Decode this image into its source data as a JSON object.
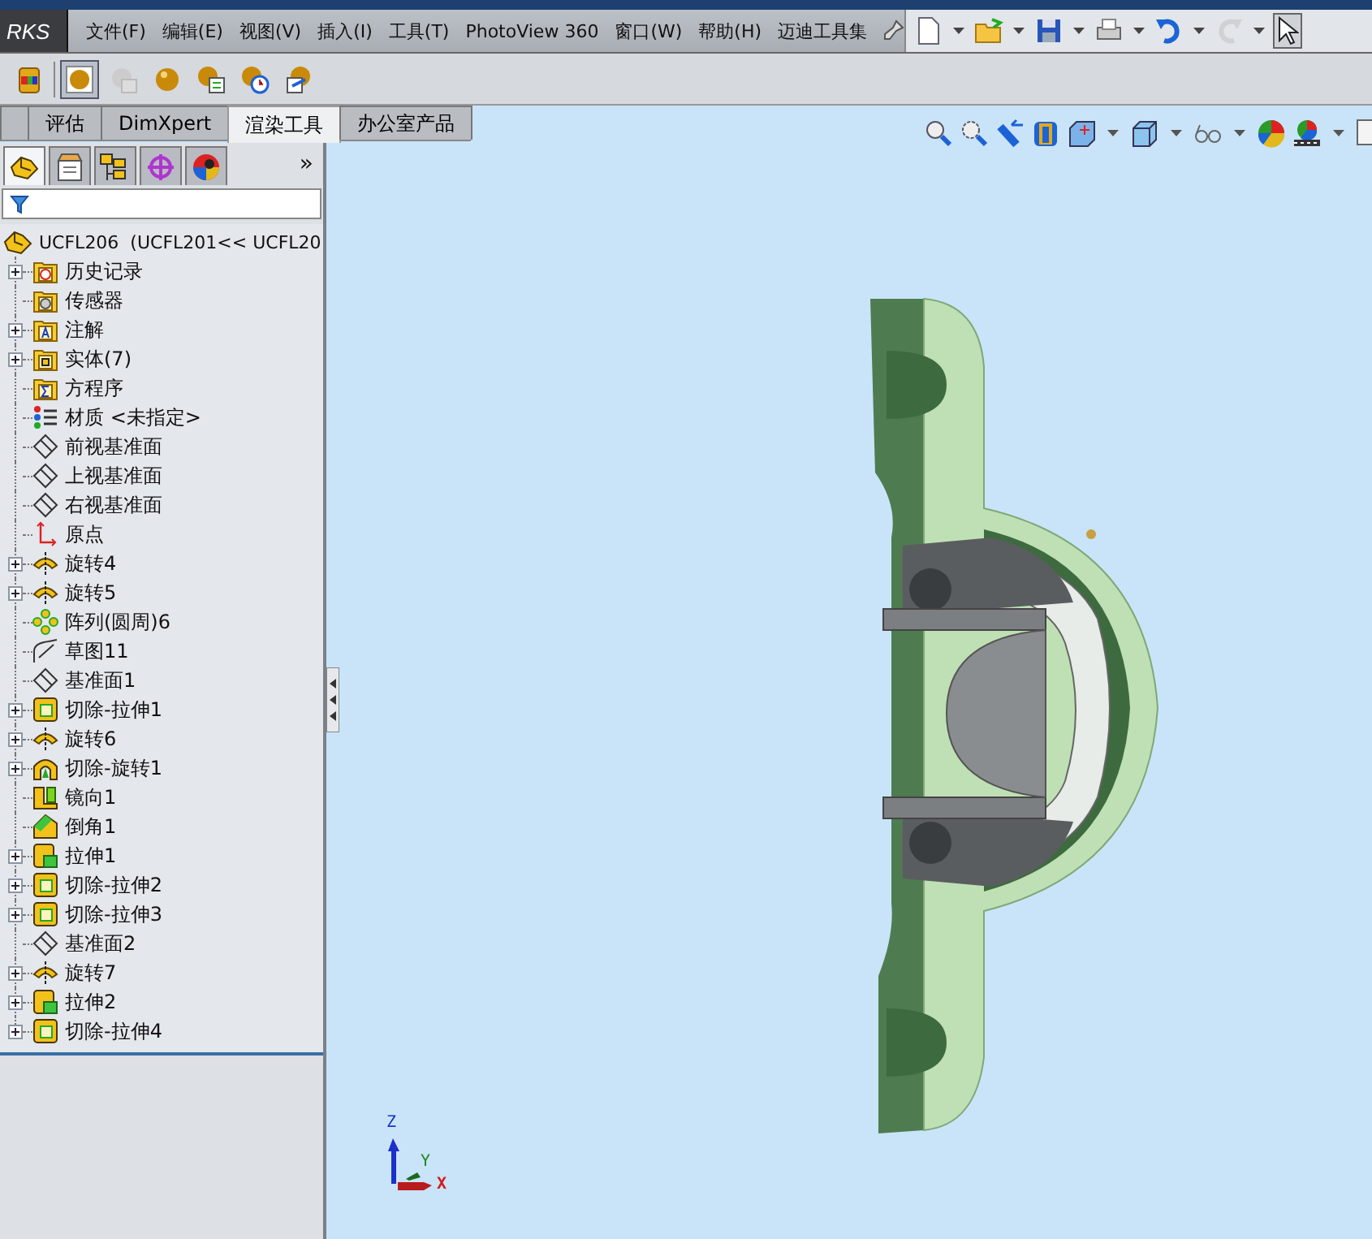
{
  "logo": "RKS",
  "menu": [
    "文件(F)",
    "编辑(E)",
    "视图(V)",
    "插入(I)",
    "工具(T)",
    "PhotoView 360",
    "窗口(W)",
    "帮助(H)",
    "迈迪工具集"
  ],
  "quick_toolbar": [
    {
      "kind": "new",
      "disabled": false
    },
    {
      "kind": "open",
      "disabled": false
    },
    {
      "kind": "save",
      "disabled": false
    },
    {
      "kind": "print",
      "disabled": false
    },
    {
      "kind": "undo",
      "disabled": false
    },
    {
      "kind": "redo",
      "disabled": true
    }
  ],
  "render_toolbar": [
    {
      "kind": "cylinder",
      "selected": false
    },
    {
      "kind": "preview",
      "selected": true
    },
    {
      "kind": "camera",
      "selected": false
    },
    {
      "kind": "sphere",
      "selected": false
    },
    {
      "kind": "sphere_list",
      "selected": false
    },
    {
      "kind": "sphere_clock",
      "selected": false
    },
    {
      "kind": "sphere_export",
      "selected": false
    }
  ],
  "tabs": [
    {
      "selected": false
    },
    {
      "label": "评估",
      "selected": false
    },
    {
      "label": "DimXpert",
      "selected": false
    },
    {
      "label": "渲染工具",
      "selected": true
    },
    {
      "label": "办公室产品",
      "selected": false
    }
  ],
  "panel_tabs": [
    {
      "kind": "feature",
      "selected": true
    },
    {
      "kind": "property",
      "selected": false
    },
    {
      "kind": "config",
      "selected": false
    },
    {
      "kind": "dimxpert",
      "selected": false
    },
    {
      "kind": "display",
      "selected": false
    }
  ],
  "panel_more": "»",
  "feature_tree": {
    "root": "UCFL206  (UCFL201<< UCFL20",
    "items": [
      {
        "label": "历史记录",
        "kind": "history",
        "collapsed": true
      },
      {
        "label": "传感器",
        "kind": "sensor",
        "collapsed": false
      },
      {
        "label": "注解",
        "kind": "annotation",
        "collapsed": true
      },
      {
        "label": "实体(7)",
        "kind": "bodies",
        "collapsed": true
      },
      {
        "label": "方程序",
        "kind": "equation",
        "collapsed": false
      },
      {
        "label": "材质 <未指定>",
        "kind": "material",
        "collapsed": false
      },
      {
        "label": "前视基准面",
        "kind": "plane",
        "collapsed": false
      },
      {
        "label": "上视基准面",
        "kind": "plane",
        "collapsed": false
      },
      {
        "label": "右视基准面",
        "kind": "plane",
        "collapsed": false
      },
      {
        "label": "原点",
        "kind": "origin",
        "collapsed": false
      },
      {
        "label": "旋转4",
        "kind": "revolve",
        "collapsed": true
      },
      {
        "label": "旋转5",
        "kind": "revolve",
        "collapsed": true
      },
      {
        "label": "阵列(圆周)6",
        "kind": "pattern",
        "collapsed": false
      },
      {
        "label": "草图11",
        "kind": "sketch",
        "collapsed": false
      },
      {
        "label": "基准面1",
        "kind": "plane",
        "collapsed": false
      },
      {
        "label": "切除-拉伸1",
        "kind": "cut_extrude",
        "collapsed": true
      },
      {
        "label": "旋转6",
        "kind": "revolve",
        "collapsed": true
      },
      {
        "label": "切除-旋转1",
        "kind": "cut_revolve",
        "collapsed": true
      },
      {
        "label": "镜向1",
        "kind": "mirror",
        "collapsed": false
      },
      {
        "label": "倒角1",
        "kind": "chamfer",
        "collapsed": false
      },
      {
        "label": "拉伸1",
        "kind": "extrude",
        "collapsed": true
      },
      {
        "label": "切除-拉伸2",
        "kind": "cut_extrude",
        "collapsed": true
      },
      {
        "label": "切除-拉伸3",
        "kind": "cut_extrude",
        "collapsed": true
      },
      {
        "label": "基准面2",
        "kind": "plane",
        "collapsed": false
      },
      {
        "label": "旋转7",
        "kind": "revolve",
        "collapsed": true
      },
      {
        "label": "拉伸2",
        "kind": "extrude",
        "collapsed": true
      },
      {
        "label": "切除-拉伸4",
        "kind": "cut_extrude",
        "collapsed": true
      }
    ]
  },
  "triad": {
    "z": "Z",
    "y": "Y",
    "x": "X"
  }
}
